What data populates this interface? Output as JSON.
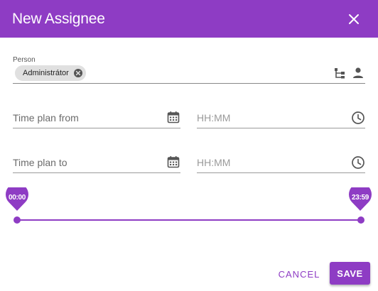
{
  "dialog": {
    "title": "New Assignee",
    "close_icon": "close-icon"
  },
  "person": {
    "label": "Person",
    "chip_value": "Administrátor",
    "chip_remove_icon": "cancel-circle-icon",
    "tree_icon": "org-tree-icon",
    "person_icon": "person-icon"
  },
  "time_plan_from": {
    "date_placeholder": "Time plan from",
    "time_placeholder": "HH:MM",
    "calendar_icon": "calendar-icon",
    "clock_icon": "clock-icon"
  },
  "time_plan_to": {
    "date_placeholder": "Time plan to",
    "time_placeholder": "HH:MM",
    "calendar_icon": "calendar-icon",
    "clock_icon": "clock-icon"
  },
  "time_range_slider": {
    "start_label": "00:00",
    "end_label": "23:59",
    "start_fraction": 0,
    "end_fraction": 1
  },
  "actions": {
    "cancel_label": "CANCEL",
    "save_label": "SAVE"
  },
  "colors": {
    "accent": "#8e3cc4",
    "chip_background": "#e0e0e0"
  }
}
